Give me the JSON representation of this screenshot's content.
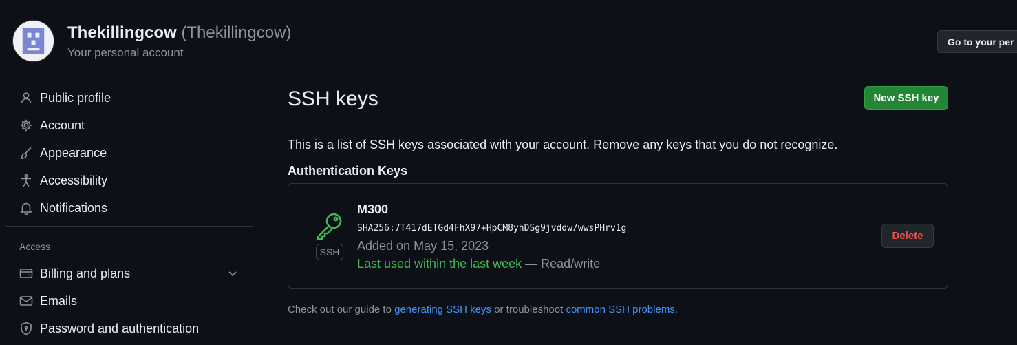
{
  "account": {
    "display_name": "Thekillingcow",
    "handle": "(Thekillingcow)",
    "subtitle": "Your personal account",
    "goto_button": "Go to your per"
  },
  "sidebar": {
    "items": [
      {
        "label": "Public profile",
        "icon": "person-icon"
      },
      {
        "label": "Account",
        "icon": "gear-icon"
      },
      {
        "label": "Appearance",
        "icon": "paintbrush-icon"
      },
      {
        "label": "Accessibility",
        "icon": "accessibility-icon"
      },
      {
        "label": "Notifications",
        "icon": "bell-icon"
      }
    ],
    "access_label": "Access",
    "access_items": [
      {
        "label": "Billing and plans",
        "icon": "credit-card-icon"
      },
      {
        "label": "Emails",
        "icon": "mail-icon"
      },
      {
        "label": "Password and authentication",
        "icon": "shield-lock-icon"
      }
    ]
  },
  "main": {
    "title": "SSH keys",
    "new_button": "New SSH key",
    "intro": "This is a list of SSH keys associated with your account. Remove any keys that you do not recognize.",
    "auth_heading": "Authentication Keys",
    "keys": [
      {
        "title": "M300",
        "fingerprint": "SHA256:7T417dETGd4FhX97+HpCM8yhDSg9jvddw/wwsPHrv1g",
        "badge": "SSH",
        "added": "Added on May 15, 2023",
        "last_used": "Last used within the last week",
        "access": "— Read/write",
        "delete_label": "Delete"
      }
    ],
    "footer": {
      "prefix": "Check out our guide to ",
      "link1": "generating SSH keys",
      "middle": " or troubleshoot ",
      "link2": "common SSH problems",
      "suffix": "."
    }
  },
  "colors": {
    "background": "#0d1117",
    "accent_green": "#238636",
    "success_text": "#3fb950",
    "danger_text": "#f85149",
    "link": "#4493f8"
  }
}
